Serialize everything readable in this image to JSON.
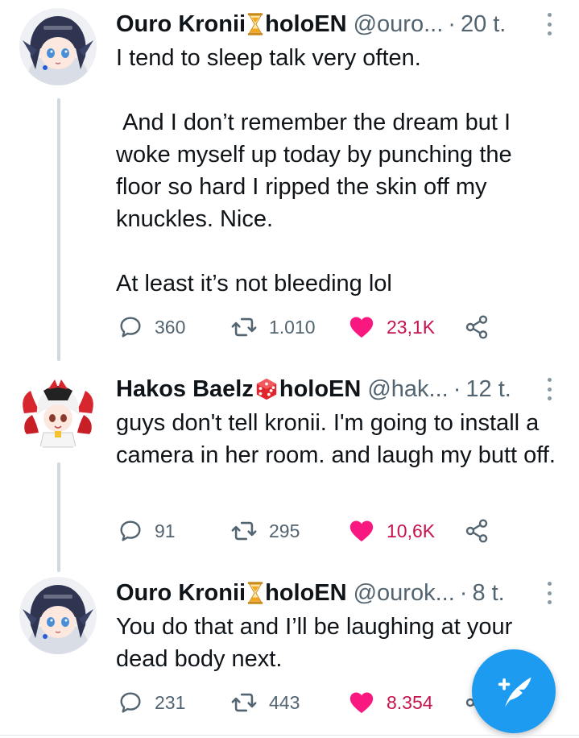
{
  "thread": [
    {
      "display_name": "Ouro Kronii",
      "badge_icon": "hourglass-emoji",
      "affiliation": "holoEN",
      "handle": "@ouro...",
      "separator": "·",
      "time": "20 t.",
      "text": "I tend to sleep talk very often.\n\n And I don’t remember the dream but I woke myself up today by punching the floor so hard I ripped the skin off my knuckles. Nice.\n\nAt least it’s not bleeding lol",
      "replies": "360",
      "retweets": "1.010",
      "likes": "23,1K",
      "avatar_icon": "kronii-avatar"
    },
    {
      "display_name": "Hakos Baelz",
      "badge_icon": "die-emoji",
      "affiliation": "holoEN",
      "handle": "@hak...",
      "separator": "·",
      "time": "12 t.",
      "text": "guys don't tell kronii. I'm going to install a camera in her room. and laugh my butt off.",
      "replies": "91",
      "retweets": "295",
      "likes": "10,6K",
      "avatar_icon": "baelz-avatar"
    },
    {
      "display_name": "Ouro Kronii",
      "badge_icon": "hourglass-emoji",
      "affiliation": "holoEN",
      "handle": "@ourok...",
      "separator": "·",
      "time": "8 t.",
      "text": "You do that and I’ll be laughing at your dead body next.",
      "replies": "231",
      "retweets": "443",
      "likes": "8.354",
      "avatar_icon": "kronii-avatar"
    }
  ],
  "compose_button_icon": "compose-tweet-icon",
  "colors": {
    "like": "#f91880",
    "like_text": "#c5134b",
    "muted": "#536471",
    "accent": "#1d9bf0",
    "thread_line": "#cfd9de"
  }
}
